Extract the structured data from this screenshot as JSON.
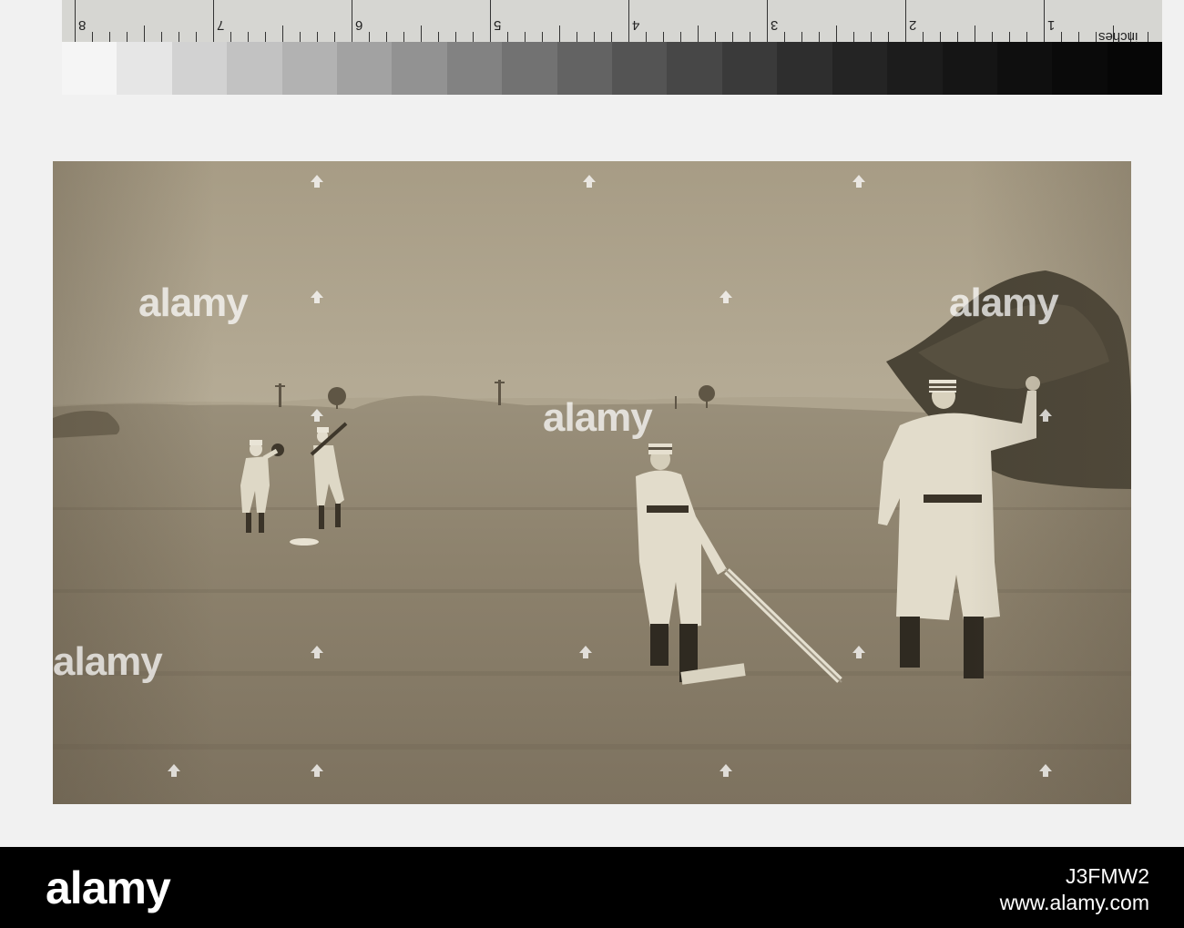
{
  "ruler": {
    "unit_label": "inches",
    "numbers": [
      "8",
      "7",
      "6",
      "5",
      "4",
      "3",
      "2",
      "1"
    ],
    "gray_steps": [
      "#f5f5f5",
      "#e6e6e6",
      "#d2d2d2",
      "#c2c2c2",
      "#b2b2b2",
      "#a2a2a2",
      "#929292",
      "#828282",
      "#727272",
      "#636363",
      "#545454",
      "#474747",
      "#3a3a3a",
      "#2e2e2e",
      "#242424",
      "#1c1c1c",
      "#151515",
      "#0f0f0f",
      "#0a0a0a",
      "#060606"
    ]
  },
  "watermark": {
    "text": "alamy"
  },
  "footer": {
    "logo": "alamy",
    "image_id": "J3FMW2",
    "url": "www.alamy.com",
    "background": "#000000"
  },
  "photo": {
    "sky_color": "#bdb49f",
    "field_color": "#8d826d"
  }
}
